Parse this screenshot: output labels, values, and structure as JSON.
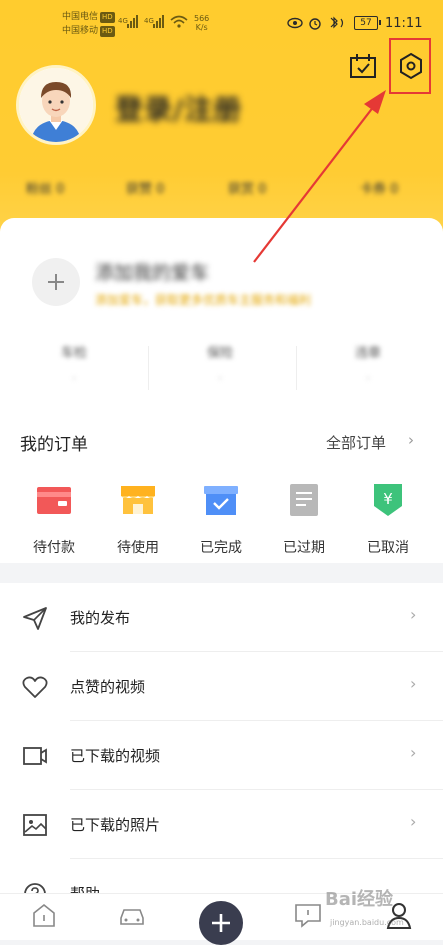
{
  "status_bar": {
    "carrier1": "中国电信",
    "carrier2": "中国移动",
    "hd_badge": "HD",
    "net_speed_value": "566",
    "net_speed_unit": "K/s",
    "battery": "57",
    "time": "11:11"
  },
  "header": {
    "login_title": "登录/注册",
    "stats": [
      "粉丝 0",
      "获赞 0",
      "获赏 0",
      "卡券 0"
    ]
  },
  "add_car": {
    "title": "添加我的爱车",
    "subtitle": "添加爱车，获取更多优质车主服务和福利"
  },
  "mini_stats": [
    {
      "label": "车检",
      "value": "-"
    },
    {
      "label": "保险",
      "value": "-"
    },
    {
      "label": "违章",
      "value": "-"
    }
  ],
  "orders": {
    "title": "我的订单",
    "all_label": "全部订单",
    "chevron": "›",
    "items": [
      {
        "label": "待付款",
        "icon": "wallet-icon",
        "color": "#f25858"
      },
      {
        "label": "待使用",
        "icon": "shop-icon",
        "color": "#ffb21f"
      },
      {
        "label": "已完成",
        "icon": "box-check-icon",
        "color": "#4f8ff7"
      },
      {
        "label": "已过期",
        "icon": "document-icon",
        "color": "#b3b3b3"
      },
      {
        "label": "已取消",
        "icon": "yuan-shield-icon",
        "color": "#3dc37b"
      }
    ]
  },
  "menu": [
    {
      "label": "我的发布",
      "icon": "paper-plane-icon"
    },
    {
      "label": "点赞的视频",
      "icon": "heart-icon"
    },
    {
      "label": "已下载的视频",
      "icon": "video-camera-icon"
    },
    {
      "label": "已下载的照片",
      "icon": "image-icon"
    },
    {
      "label": "帮助",
      "icon": "help-icon"
    }
  ],
  "menu_chevron": "›",
  "bottom_nav": [
    "home-icon",
    "car-icon",
    "add-icon",
    "message-icon",
    "profile-icon"
  ],
  "watermark": {
    "text": "Bai经验",
    "url": "jingyan.baidu.com"
  },
  "colors": {
    "header": "#ffcc2e",
    "highlight": "#e53935",
    "fab": "#3a3d4f"
  }
}
